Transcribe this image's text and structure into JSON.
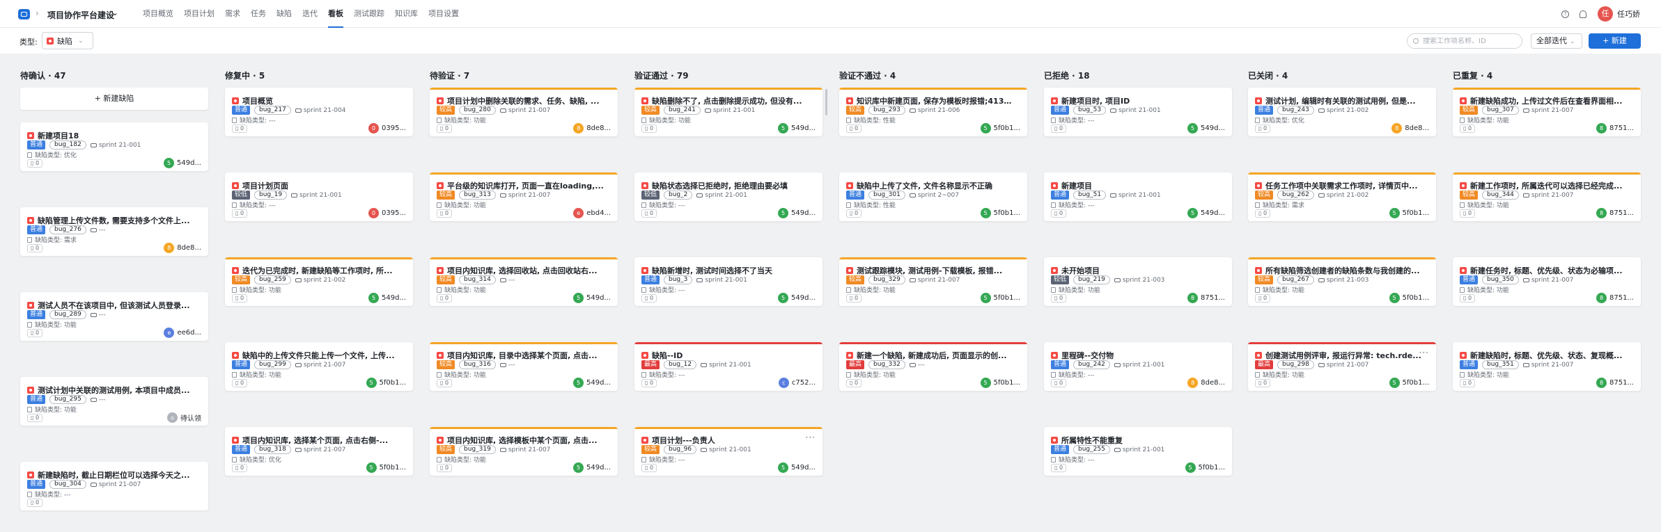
{
  "header": {
    "project": "项目协作平台建设",
    "nav": [
      "项目概览",
      "项目计划",
      "需求",
      "任务",
      "缺陷",
      "迭代",
      "看板",
      "测试跟踪",
      "知识库",
      "项目设置"
    ],
    "active_nav": "看板",
    "help_icon": "?",
    "avatar": "任",
    "user": "任巧娇"
  },
  "filter": {
    "type_label": "类型:",
    "type_value": "缺陷",
    "search_placeholder": "搜索工作项名称、ID",
    "iteration": "全部迭代",
    "new_button": "+ 新建"
  },
  "colors": {
    "普通": "#3c7fe0",
    "较低": "#5b6375",
    "较高": "#f08a24",
    "最高": "#e23d3d",
    "orange_line": "#f5a524",
    "red_line": "#e23d3d"
  },
  "board": {
    "add_bug_label": "+ 新建缺陷",
    "columns": [
      {
        "title": "待确认 · 47",
        "cards": [
          {
            "title": "新建项目18",
            "prio": "普通",
            "bug": "bug_182",
            "sprint": "sprint 21-001",
            "cat": "缺陷类型: 优化",
            "count": "0",
            "owner": "549d...",
            "av": "5",
            "avc": "#34a853",
            "line": ""
          },
          {
            "title": "缺陷管理上传文件数, 需要支持多个文件上...",
            "prio": "普通",
            "bug": "bug_276",
            "sprint": "---",
            "cat": "缺陷类型: 需求",
            "count": "0",
            "owner": "8de8...",
            "av": "8",
            "avc": "#f5a524",
            "line": ""
          },
          {
            "title": "测试人员不在该项目中, 但该测试人员登录...",
            "prio": "普通",
            "bug": "bug_289",
            "sprint": "---",
            "cat": "缺陷类型: 功能",
            "count": "0",
            "owner": "ee6d...",
            "av": "e",
            "avc": "#5b7fe0",
            "line": ""
          },
          {
            "title": "测试计划中关联的测试用例, 本项目中成员...",
            "prio": "普通",
            "bug": "bug_295",
            "sprint": "---",
            "cat": "缺陷类型: 功能",
            "count": "0",
            "owner": "待认领",
            "av": "⌂",
            "avc": "#b0b4ba",
            "line": ""
          },
          {
            "title": "新建缺陷时, 截止日期栏位可以选择今天之...",
            "prio": "普通",
            "bug": "bug_304",
            "sprint": "sprint 21-007",
            "cat": "缺陷类型: ---",
            "count": "0",
            "owner": "",
            "av": "",
            "avc": "",
            "line": ""
          }
        ]
      },
      {
        "title": "修复中 · 5",
        "cards": [
          {
            "title": "项目概览",
            "prio": "普通",
            "bug": "bug_217",
            "sprint": "sprint 21-004",
            "cat": "缺陷类型: ---",
            "count": "0",
            "owner": "0395...",
            "av": "0",
            "avc": "#e5554f",
            "line": ""
          },
          {
            "title": "项目计划页面",
            "prio": "较低",
            "bug": "bug_19",
            "sprint": "sprint 21-001",
            "cat": "缺陷类型: ---",
            "count": "0",
            "owner": "0395...",
            "av": "0",
            "avc": "#e5554f",
            "line": ""
          },
          {
            "title": "迭代为已完成时, 新建缺陷等工作项时, 所...",
            "prio": "较高",
            "bug": "bug_259",
            "sprint": "sprint 21-002",
            "cat": "缺陷类型: 功能",
            "count": "0",
            "owner": "549d...",
            "av": "5",
            "avc": "#34a853",
            "line": "orange"
          },
          {
            "title": "缺陷中的上传文件只能上传一个文件, 上传...",
            "prio": "普通",
            "bug": "bug_299",
            "sprint": "sprint 21-007",
            "cat": "缺陷类型: 功能",
            "count": "0",
            "owner": "5f0b1...",
            "av": "5",
            "avc": "#34a853",
            "line": ""
          },
          {
            "title": "项目内知识库, 选择某个页面, 点击右侧-...",
            "prio": "普通",
            "bug": "bug_318",
            "sprint": "sprint 21-007",
            "cat": "缺陷类型: 优化",
            "count": "0",
            "owner": "5f0b1...",
            "av": "5",
            "avc": "#34a853",
            "line": ""
          }
        ]
      },
      {
        "title": "待验证 · 7",
        "cards": [
          {
            "title": "项目计划中删除关联的需求、任务、缺陷, ...",
            "prio": "较高",
            "bug": "bug_280",
            "sprint": "sprint 21-007",
            "cat": "缺陷类型: 功能",
            "count": "0",
            "owner": "8de8...",
            "av": "8",
            "avc": "#f5a524",
            "line": "orange"
          },
          {
            "title": "平台级的知识库打开, 页面一直在loading,...",
            "prio": "较高",
            "bug": "bug_313",
            "sprint": "sprint 21-007",
            "cat": "缺陷类型: 功能",
            "count": "0",
            "owner": "ebd4...",
            "av": "e",
            "avc": "#e5554f",
            "line": "orange"
          },
          {
            "title": "项目内知识库, 选择回收站, 点击回收站右...",
            "prio": "较高",
            "bug": "bug_314",
            "sprint": "---",
            "cat": "缺陷类型: 功能",
            "count": "0",
            "owner": "549d...",
            "av": "5",
            "avc": "#34a853",
            "line": "orange"
          },
          {
            "title": "项目内知识库, 目录中选择某个页面, 点击...",
            "prio": "较高",
            "bug": "bug_316",
            "sprint": "---",
            "cat": "缺陷类型: 功能",
            "count": "0",
            "owner": "549d...",
            "av": "5",
            "avc": "#34a853",
            "line": "orange"
          },
          {
            "title": "项目内知识库, 选择模板中某个页面, 点击...",
            "prio": "较高",
            "bug": "bug_319",
            "sprint": "sprint 21-007",
            "cat": "缺陷类型: 功能",
            "count": "0",
            "owner": "549d...",
            "av": "5",
            "avc": "#34a853",
            "line": "orange"
          }
        ]
      },
      {
        "title": "验证通过 · 79",
        "cards": [
          {
            "title": "缺陷删除不了, 点击删除提示成功, 但没有...",
            "prio": "较高",
            "bug": "bug_241",
            "sprint": "sprint 21-001",
            "cat": "缺陷类型: 功能",
            "count": "0",
            "owner": "549d...",
            "av": "5",
            "avc": "#34a853",
            "line": "orange"
          },
          {
            "title": "缺陷状态选择已拒绝时, 拒绝理由要必填",
            "prio": "较低",
            "bug": "bug_2",
            "sprint": "sprint 21-001",
            "cat": "缺陷类型: ---",
            "count": "0",
            "owner": "549d...",
            "av": "5",
            "avc": "#34a853",
            "line": ""
          },
          {
            "title": "缺陷新增时, 测试时间选择不了当天",
            "prio": "普通",
            "bug": "bug_3",
            "sprint": "sprint 21-001",
            "cat": "缺陷类型: ---",
            "count": "0",
            "owner": "549d...",
            "av": "5",
            "avc": "#34a853",
            "line": ""
          },
          {
            "title": "缺陷--ID",
            "prio": "最高",
            "bug": "bug_12",
            "sprint": "sprint 21-001",
            "cat": "缺陷类型: ---",
            "count": "0",
            "owner": "c752...",
            "av": "c",
            "avc": "#5b7fe0",
            "line": "red"
          },
          {
            "title": "项目计划---负责人",
            "prio": "较高",
            "bug": "bug_96",
            "sprint": "sprint 21-001",
            "cat": "缺陷类型: ---",
            "count": "0",
            "owner": "549d...",
            "av": "5",
            "avc": "#34a853",
            "line": "orange",
            "more": "···"
          }
        ]
      },
      {
        "title": "验证不通过 · 4",
        "cards": [
          {
            "title": "知识库中新建页面, 保存为模板时报错;413 ...",
            "prio": "较高",
            "bug": "bug_293",
            "sprint": "sprint 21-006",
            "cat": "缺陷类型: 性能",
            "count": "0",
            "owner": "5f0b1...",
            "av": "5",
            "avc": "#34a853",
            "line": "orange"
          },
          {
            "title": "缺陷中上传了文件, 文件名称显示不正确",
            "prio": "普通",
            "bug": "bug_301",
            "sprint": "sprint 2~007",
            "cat": "缺陷类型: 性能",
            "count": "0",
            "owner": "5f0b1...",
            "av": "5",
            "avc": "#34a853",
            "line": ""
          },
          {
            "title": "测试跟踪模块, 测试用例-下载模板, 报错...",
            "prio": "较高",
            "bug": "bug_329",
            "sprint": "sprint 21-007",
            "cat": "缺陷类型: 功能",
            "count": "0",
            "owner": "5f0b1...",
            "av": "5",
            "avc": "#34a853",
            "line": "orange"
          },
          {
            "title": "新建一个缺陷, 新建成功后, 页面显示的创...",
            "prio": "最高",
            "bug": "bug_332",
            "sprint": "---",
            "cat": "缺陷类型: 功能",
            "count": "0",
            "owner": "5f0b1...",
            "av": "5",
            "avc": "#34a853",
            "line": "red"
          }
        ]
      },
      {
        "title": "已拒绝 · 18",
        "cards": [
          {
            "title": "新建项目时, 项目ID",
            "prio": "普通",
            "bug": "bug_53",
            "sprint": "sprint 21-001",
            "cat": "缺陷类型: ---",
            "count": "0",
            "owner": "549d...",
            "av": "5",
            "avc": "#34a853",
            "line": ""
          },
          {
            "title": "新建项目",
            "prio": "普通",
            "bug": "bug_51",
            "sprint": "sprint 21-001",
            "cat": "缺陷类型: ---",
            "count": "0",
            "owner": "549d...",
            "av": "5",
            "avc": "#34a853",
            "line": ""
          },
          {
            "title": "未开始项目",
            "prio": "较低",
            "bug": "bug_219",
            "sprint": "sprint 21-003",
            "cat": "缺陷类型: 功能",
            "count": "0",
            "owner": "8751...",
            "av": "8",
            "avc": "#34a853",
            "line": ""
          },
          {
            "title": "里程碑--交付物",
            "prio": "普通",
            "bug": "bug_242",
            "sprint": "sprint 21-001",
            "cat": "缺陷类型: ---",
            "count": "0",
            "owner": "8de8...",
            "av": "8",
            "avc": "#f5a524",
            "line": ""
          },
          {
            "title": "所属特性不能重复",
            "prio": "普通",
            "bug": "bug_255",
            "sprint": "sprint 21-001",
            "cat": "缺陷类型: ---",
            "count": "0",
            "owner": "5f0b1...",
            "av": "5",
            "avc": "#34a853",
            "line": ""
          }
        ]
      },
      {
        "title": "已关闭 · 4",
        "cards": [
          {
            "title": "测试计划, 编辑时有关联的测试用例, 但是...",
            "prio": "普通",
            "bug": "bug_243",
            "sprint": "sprint 21-002",
            "cat": "缺陷类型: 优化",
            "count": "0",
            "owner": "8de8...",
            "av": "8",
            "avc": "#f5a524",
            "line": ""
          },
          {
            "title": "任务工作项中关联需求工作项时, 详情页中...",
            "prio": "较高",
            "bug": "bug_262",
            "sprint": "sprint 21-002",
            "cat": "缺陷类型: 需求",
            "count": "0",
            "owner": "5f0b1...",
            "av": "5",
            "avc": "#34a853",
            "line": "orange"
          },
          {
            "title": "所有缺陷筛选创建者的缺陷条数与我创建的...",
            "prio": "较高",
            "bug": "bug_267",
            "sprint": "sprint 21-003",
            "cat": "缺陷类型: 功能",
            "count": "0",
            "owner": "5f0b1...",
            "av": "5",
            "avc": "#34a853",
            "line": "orange"
          },
          {
            "title": "创建测试用例评审, 报运行异常: tech.rde...",
            "prio": "最高",
            "bug": "bug_298",
            "sprint": "sprint 21-007",
            "cat": "缺陷类型: 功能",
            "count": "0",
            "owner": "5f0b1...",
            "av": "5",
            "avc": "#34a853",
            "line": "red",
            "more": "···"
          }
        ]
      },
      {
        "title": "已重复 · 4",
        "cards": [
          {
            "title": "新建缺陷成功, 上传过文件后在查看界面相...",
            "prio": "较高",
            "bug": "bug_307",
            "sprint": "sprint 21-007",
            "cat": "缺陷类型: 功能",
            "count": "0",
            "owner": "8751...",
            "av": "8",
            "avc": "#34a853",
            "line": "orange"
          },
          {
            "title": "新建工作项时, 所属迭代可以选择已经完成...",
            "prio": "较高",
            "bug": "bug_344",
            "sprint": "sprint 21-007",
            "cat": "缺陷类型: 功能",
            "count": "0",
            "owner": "8751...",
            "av": "8",
            "avc": "#34a853",
            "line": "orange"
          },
          {
            "title": "新建任务时, 标题、优先级、状态为必输项...",
            "prio": "普通",
            "bug": "bug_350",
            "sprint": "sprint 21-007",
            "cat": "缺陷类型: 功能",
            "count": "0",
            "owner": "8751...",
            "av": "8",
            "avc": "#34a853",
            "line": ""
          },
          {
            "title": "新建缺陷时, 标题、优先级、状态、复现概...",
            "prio": "普通",
            "bug": "bug_351",
            "sprint": "sprint 21-007",
            "cat": "缺陷类型: 功能",
            "count": "0",
            "owner": "8751...",
            "av": "8",
            "avc": "#34a853",
            "line": ""
          }
        ]
      }
    ]
  }
}
